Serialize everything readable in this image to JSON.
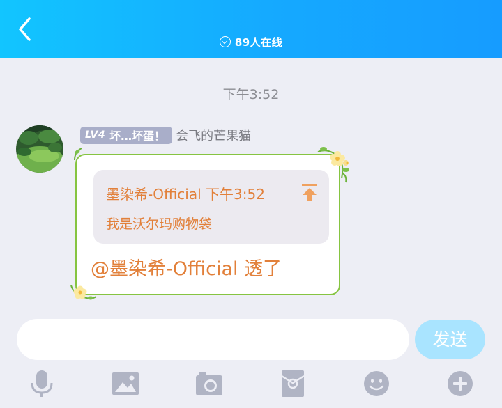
{
  "header": {
    "online_count": "89人在线",
    "accent_color": "#16b4ff",
    "icons": [
      "back-chevron-icon",
      "online-check-icon"
    ]
  },
  "chat": {
    "timestamp": "下午3:52",
    "message": {
      "level_badge": "LV4",
      "member_title": "坏…坏蛋！",
      "sender_name": "会飞的芒果猫",
      "quoted": {
        "header": "墨染希-Official 下午3:52",
        "text": "我是沃尔玛购物袋"
      },
      "text": "@墨染希-Official 透了",
      "text_color": "#e2803a",
      "bubble_border_color": "#86c441"
    }
  },
  "composer": {
    "input_value": "",
    "send_label": "发送",
    "send_color": "#a9e4ff"
  },
  "toolbar": {
    "icons": [
      "microphone-icon",
      "image-icon",
      "camera-icon",
      "red-packet-icon",
      "emoji-icon",
      "plus-icon"
    ],
    "icon_color": "#b0b4c4"
  }
}
